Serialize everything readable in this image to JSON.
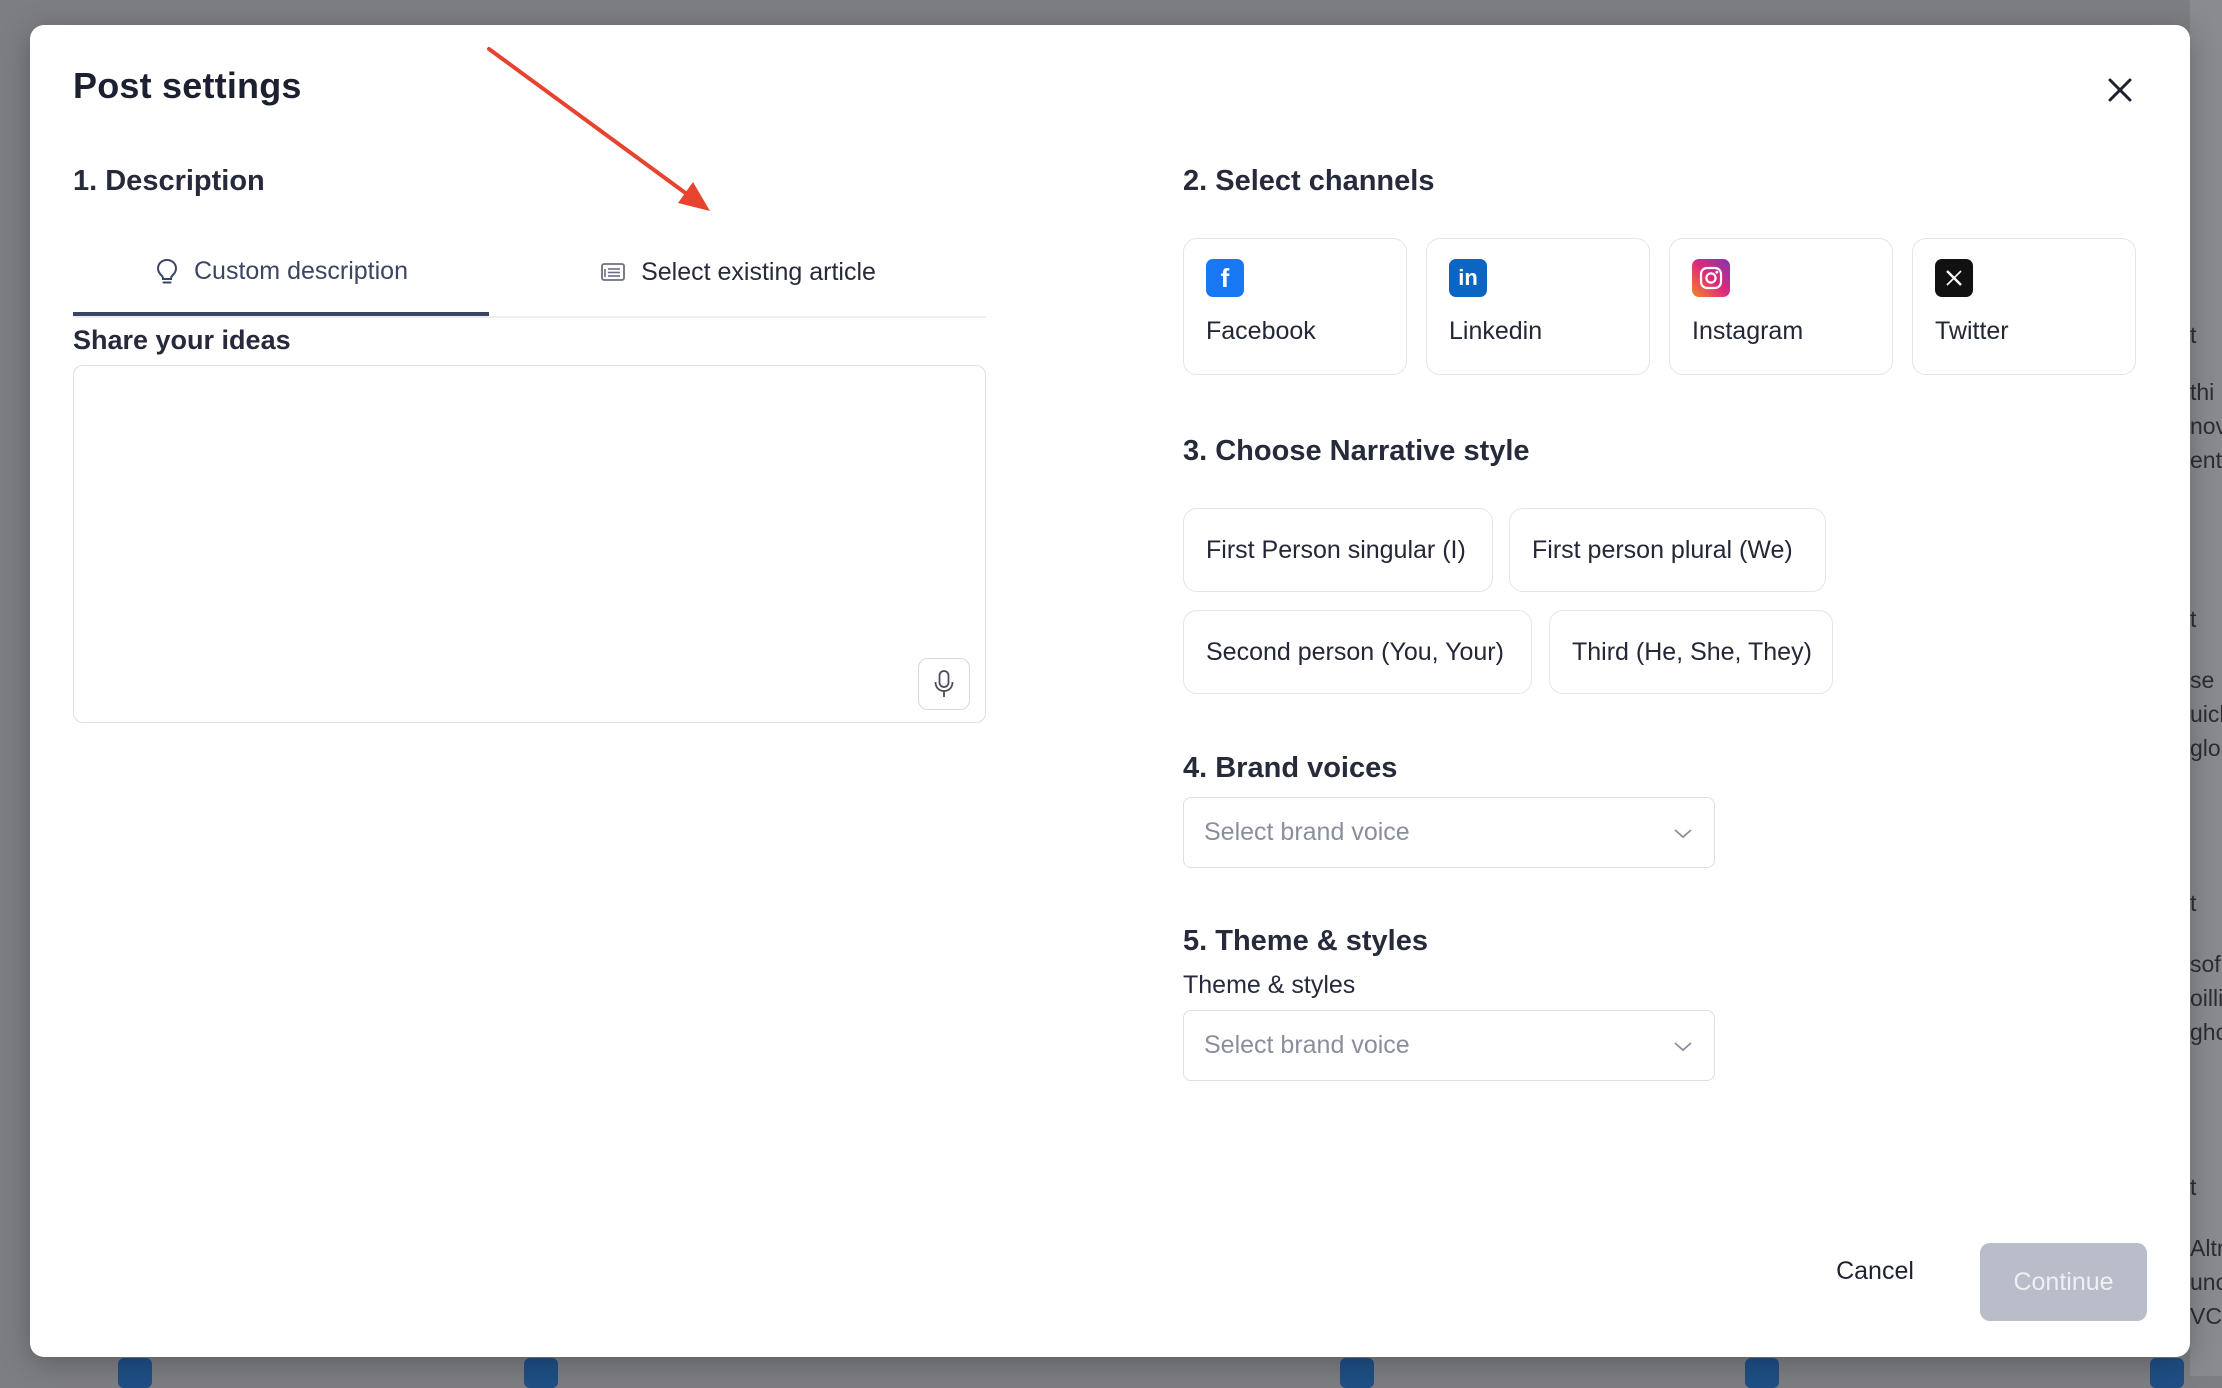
{
  "modal": {
    "title": "Post settings"
  },
  "description": {
    "heading": "1. Description",
    "tabs": [
      {
        "label": "Custom description",
        "icon": "lightbulb-icon",
        "active": true
      },
      {
        "label": "Select existing article",
        "icon": "article-icon",
        "active": false
      }
    ],
    "ideas_label": "Share your ideas",
    "ideas_value": ""
  },
  "channels": {
    "heading": "2. Select channels",
    "items": [
      {
        "label": "Facebook",
        "icon": "facebook-icon",
        "color": "#1877f2",
        "glyph": "f"
      },
      {
        "label": "Linkedin",
        "icon": "linkedin-icon",
        "color": "#0a66c2",
        "glyph": "in"
      },
      {
        "label": "Instagram",
        "icon": "instagram-icon",
        "color": "#d62976",
        "glyph": ""
      },
      {
        "label": "Twitter",
        "icon": "x-twitter-icon",
        "color": "#000000",
        "glyph": "𝕏"
      }
    ]
  },
  "narrative": {
    "heading": "3. Choose Narrative style",
    "options": [
      "First Person singular (I)",
      "First person plural (We)",
      "Second person (You, Your)",
      "Third (He, She, They)"
    ]
  },
  "brand_voices": {
    "heading": "4. Brand voices",
    "placeholder": "Select brand voice"
  },
  "theme": {
    "heading": "5. Theme & styles",
    "field_label": "Theme & styles",
    "placeholder": "Select brand voice"
  },
  "footer": {
    "cancel_label": "Cancel",
    "continue_label": "Continue"
  },
  "background": {
    "fragments": [
      "t",
      "thi",
      "nov",
      "ent",
      "t",
      "se",
      "uick",
      "glo",
      "t",
      "sof",
      "oillic",
      "ghc",
      "t",
      "Altr",
      "unc",
      "VCs"
    ]
  },
  "colors": {
    "annotation_arrow": "#e8432f",
    "tab_active": "#3b4564",
    "continue_disabled": "#b8bdc9"
  }
}
